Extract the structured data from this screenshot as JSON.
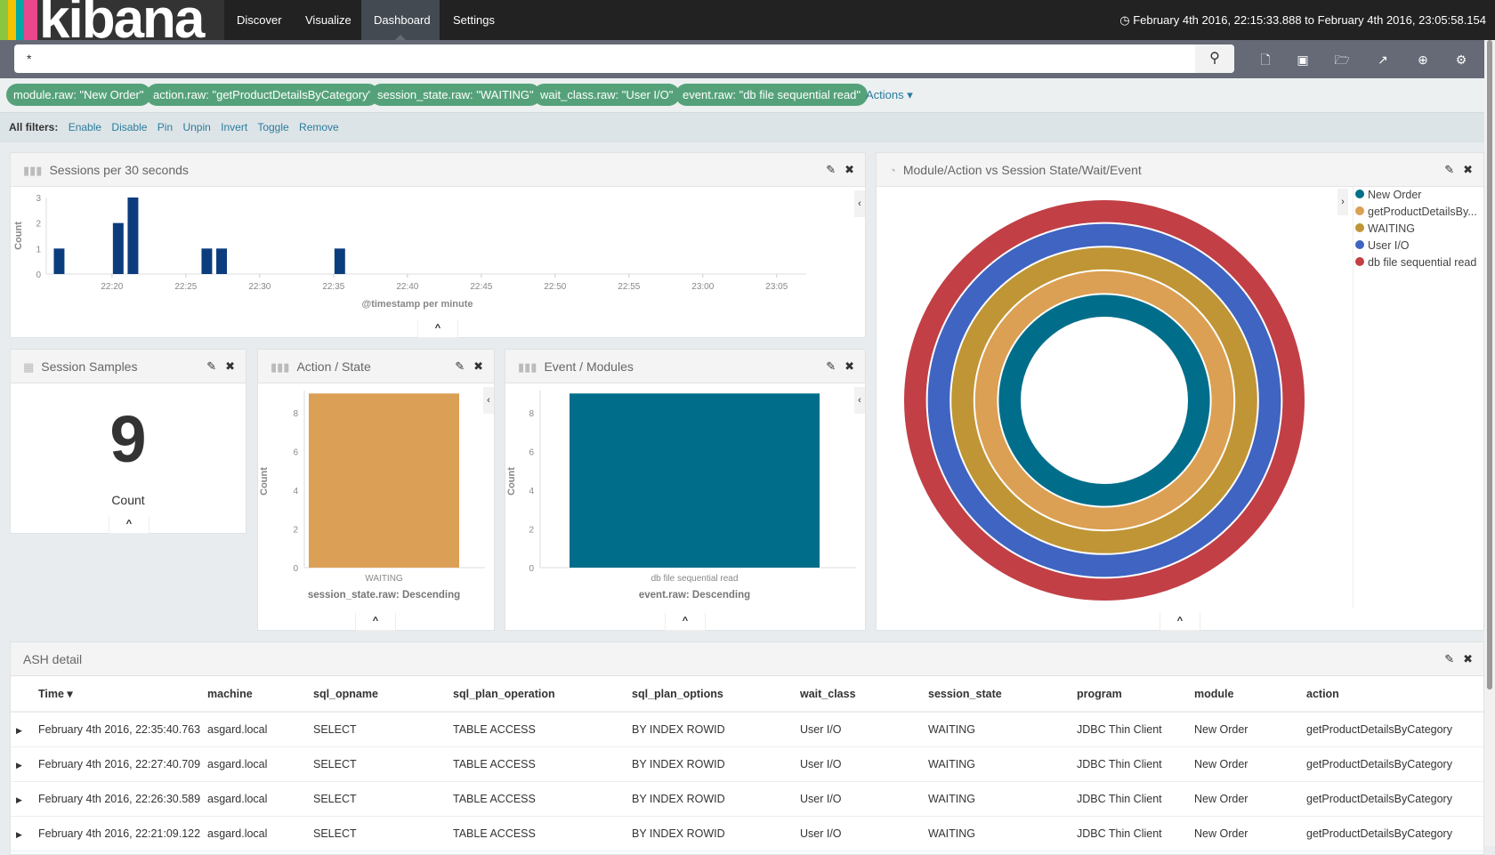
{
  "app": {
    "logo": "kibana",
    "logo_colors": [
      "#8cc63f",
      "#f5c200",
      "#00a9a6",
      "#e8478b"
    ]
  },
  "nav": [
    {
      "label": "Discover"
    },
    {
      "label": "Visualize"
    },
    {
      "label": "Dashboard",
      "active": true
    },
    {
      "label": "Settings"
    }
  ],
  "timerange": "February 4th 2016, 22:15:33.888 to February 4th 2016, 23:05:58.154",
  "search": {
    "value": "*"
  },
  "toolbar": [
    "new-dashboard-icon",
    "save-icon",
    "open-icon",
    "share-icon",
    "add-visualization-icon",
    "settings-icon"
  ],
  "filters": [
    {
      "label": "module.raw: \"New Order\""
    },
    {
      "label": "action.raw: \"getProductDetailsByCategory\""
    },
    {
      "label": "session_state.raw: \"WAITING\""
    },
    {
      "label": "wait_class.raw: \"User I/O\""
    },
    {
      "label": "event.raw: \"db file sequential read\""
    }
  ],
  "filter_actions": {
    "label": "Actions ▾",
    "all_filters": "All filters:",
    "items": [
      "Enable",
      "Disable",
      "Pin",
      "Unpin",
      "Invert",
      "Toggle",
      "Remove"
    ]
  },
  "panels": {
    "sessions": {
      "title": "Sessions per 30 seconds"
    },
    "pie": {
      "title": "Module/Action vs Session State/Wait/Event"
    },
    "samples": {
      "title": "Session Samples",
      "value": "9",
      "label": "Count"
    },
    "action_state": {
      "title": "Action / State"
    },
    "event_modules": {
      "title": "Event / Modules"
    },
    "ash": {
      "title": "ASH detail"
    }
  },
  "chart_data": [
    {
      "type": "bar",
      "title": "",
      "xlabel": "@timestamp per minute",
      "ylabel": "Count",
      "x": [
        "22:16",
        "22:20",
        "22:21",
        "22:26",
        "22:27",
        "22:35"
      ],
      "values": [
        1,
        2,
        3,
        1,
        1,
        1
      ],
      "xticks": [
        "22:20",
        "22:25",
        "22:30",
        "22:35",
        "22:40",
        "22:45",
        "22:50",
        "22:55",
        "23:00",
        "23:05"
      ],
      "yticks": [
        "0",
        "1",
        "2",
        "3"
      ],
      "ylim": [
        0,
        3
      ],
      "color": "#0b3d7e"
    },
    {
      "type": "pie",
      "donut": true,
      "legend": "right",
      "series": [
        {
          "name": "New Order",
          "value": 9,
          "color": "#006e8a"
        },
        {
          "name": "getProductDetailsBy...",
          "value": 9,
          "color": "#dba053"
        },
        {
          "name": "WAITING",
          "value": 9,
          "color": "#c09535"
        },
        {
          "name": "User I/O",
          "value": 9,
          "color": "#3f64c2"
        },
        {
          "name": "db file sequential read",
          "value": 9,
          "color": "#c23f46"
        }
      ]
    },
    {
      "type": "bar",
      "categories": [
        "WAITING"
      ],
      "values": [
        9
      ],
      "xlabel": "session_state.raw: Descending",
      "ylabel": "Count",
      "yticks": [
        "0",
        "2",
        "4",
        "6",
        "8"
      ],
      "color": "#db9f55"
    },
    {
      "type": "bar",
      "categories": [
        "db file sequential read"
      ],
      "values": [
        9
      ],
      "xlabel": "event.raw: Descending",
      "ylabel": "Count",
      "yticks": [
        "0",
        "2",
        "4",
        "6",
        "8"
      ],
      "color": "#006e8a"
    }
  ],
  "table": {
    "columns": [
      "Time ▾",
      "machine",
      "sql_opname",
      "sql_plan_operation",
      "sql_plan_options",
      "wait_class",
      "session_state",
      "program",
      "module",
      "action"
    ],
    "rows": [
      [
        "February 4th 2016, 22:35:40.763",
        "asgard.local",
        "SELECT",
        "TABLE ACCESS",
        "BY INDEX ROWID",
        "User I/O",
        "WAITING",
        "JDBC Thin Client",
        "New Order",
        "getProductDetailsByCategory"
      ],
      [
        "February 4th 2016, 22:27:40.709",
        "asgard.local",
        "SELECT",
        "TABLE ACCESS",
        "BY INDEX ROWID",
        "User I/O",
        "WAITING",
        "JDBC Thin Client",
        "New Order",
        "getProductDetailsByCategory"
      ],
      [
        "February 4th 2016, 22:26:30.589",
        "asgard.local",
        "SELECT",
        "TABLE ACCESS",
        "BY INDEX ROWID",
        "User I/O",
        "WAITING",
        "JDBC Thin Client",
        "New Order",
        "getProductDetailsByCategory"
      ],
      [
        "February 4th 2016, 22:21:09.122",
        "asgard.local",
        "SELECT",
        "TABLE ACCESS",
        "BY INDEX ROWID",
        "User I/O",
        "WAITING",
        "JDBC Thin Client",
        "New Order",
        "getProductDetailsByCategory"
      ]
    ]
  }
}
